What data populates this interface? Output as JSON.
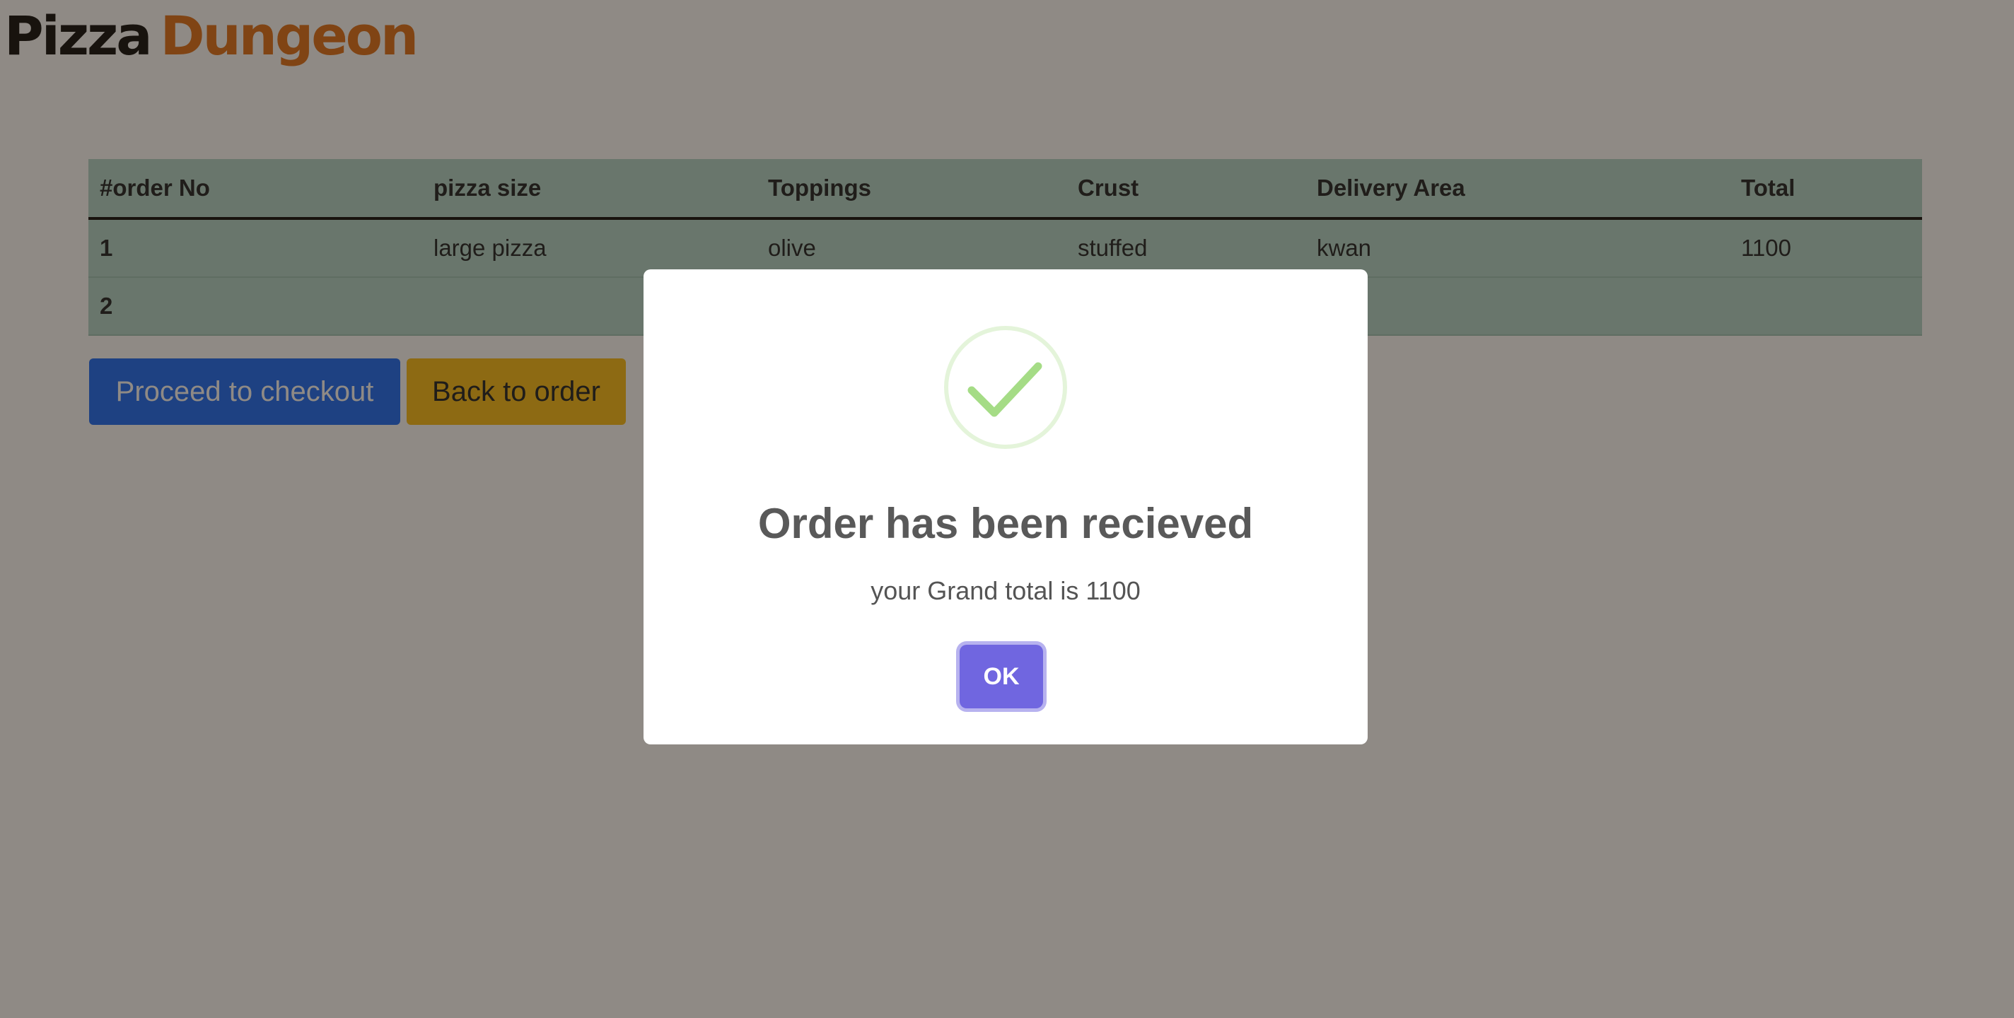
{
  "brand": {
    "word1": "Pizza",
    "word2": "Dungeon",
    "accent_color": "#e0731d"
  },
  "orders_table": {
    "headers": [
      "#order No",
      "pizza size",
      "Toppings",
      "Crust",
      "Delivery Area",
      "Total"
    ],
    "rows": [
      [
        "1",
        "large pizza",
        "olive",
        "stuffed",
        "kwan",
        "1100"
      ],
      [
        "2",
        "",
        "",
        "",
        "",
        ""
      ]
    ]
  },
  "actions": {
    "checkout_label": "Proceed to checkout",
    "back_label": "Back to order"
  },
  "modal": {
    "icon": "success-check-icon",
    "title": "Order has been recieved",
    "text": "your Grand total is 1100",
    "ok_label": "OK",
    "ok_color": "#7066e0",
    "icon_color": "#a5dc86"
  }
}
